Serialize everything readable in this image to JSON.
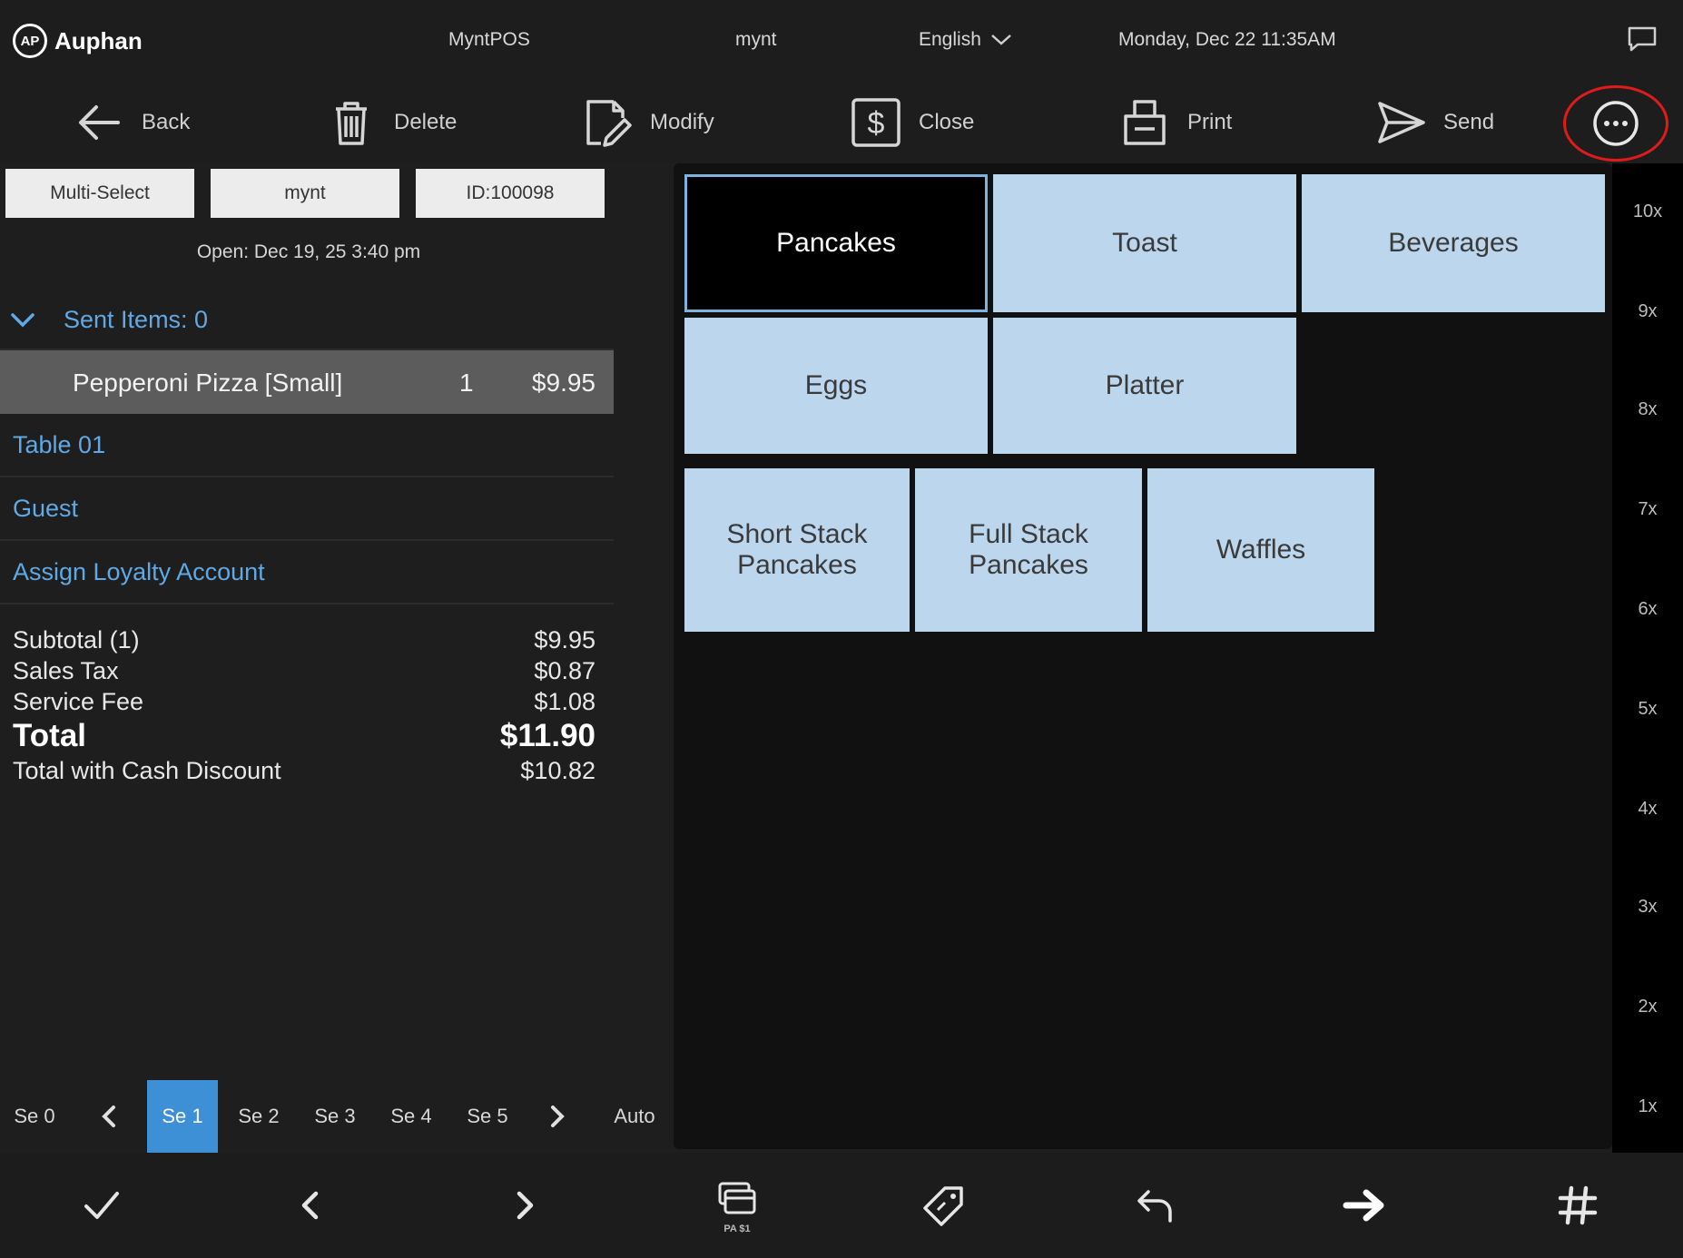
{
  "status_bar": {
    "logo_text": "Auphan",
    "logo_mark": "AP",
    "app_name": "MyntPOS",
    "user": "mynt",
    "language": "English",
    "datetime": "Monday, Dec 22 11:35AM",
    "message_icon": "message-icon"
  },
  "toolbar": {
    "back_label": "Back",
    "delete_label": "Delete",
    "modify_label": "Modify",
    "close_label": "Close",
    "print_label": "Print",
    "send_label": "Send",
    "more_icon": "more-options-icon",
    "highlight_color": "#e01b1b"
  },
  "order": {
    "multi_select_label": "Multi-Select",
    "server": "mynt",
    "order_id": "ID:100098",
    "open_time": "Open: Dec 19, 25 3:40 pm",
    "sent_items_label": "Sent Items: 0",
    "items": [
      {
        "name": "Pepperoni Pizza [Small]",
        "qty": "1",
        "price": "$9.95"
      }
    ],
    "table_label": "Table 01",
    "guest_label": "Guest",
    "loyalty_label": "Assign Loyalty Account",
    "link_color": "#5ea9e6"
  },
  "totals": {
    "subtotal_label": "Subtotal (1)",
    "subtotal_value": "$9.95",
    "tax_label": "Sales Tax",
    "tax_value": "$0.87",
    "fee_label": "Service Fee",
    "fee_value": "$1.08",
    "total_label": "Total",
    "total_value": "$11.90",
    "cash_label": "Total with Cash Discount",
    "cash_value": "$10.82"
  },
  "seats": {
    "labels": [
      "Se 0",
      "Se 1",
      "Se 2",
      "Se 3",
      "Se 4",
      "Se 5"
    ],
    "active": "Se 1",
    "auto_label": "Auto",
    "active_color": "#3d8fd6"
  },
  "menu": {
    "categories": [
      "Pancakes",
      "Toast",
      "Beverages",
      "Eggs",
      "Platter"
    ],
    "selected_category": "Pancakes",
    "items": [
      "Short Stack\nPancakes",
      "Full Stack\nPancakes",
      "Waffles"
    ],
    "tile_color": "#bcd6ee"
  },
  "quantity_multipliers": [
    "10x",
    "9x",
    "8x",
    "7x",
    "6x",
    "5x",
    "4x",
    "3x",
    "2x",
    "1x"
  ],
  "bottom_nav": {
    "confirm_icon": "check-icon",
    "prev_icon": "chevron-left-icon",
    "next_icon": "chevron-right-icon",
    "payment_icon": "card-stack-icon",
    "payment_caption": "PA $1",
    "tag_icon": "tag-icon",
    "undo_icon": "undo-icon",
    "forward_icon": "arrow-right-icon",
    "hash_icon": "hash-icon"
  }
}
